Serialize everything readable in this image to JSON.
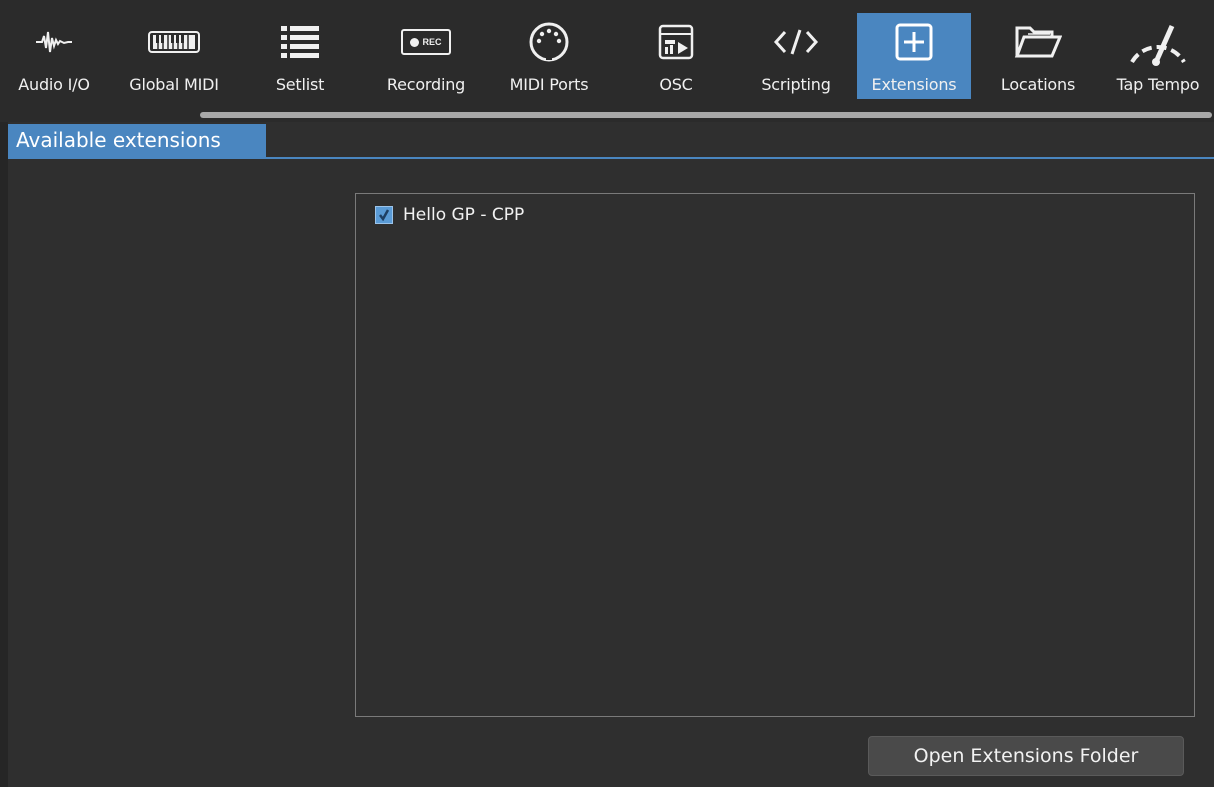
{
  "toolbar": {
    "items": [
      {
        "label": "Audio I/O",
        "icon": "waveform-icon",
        "active": false
      },
      {
        "label": "Global MIDI",
        "icon": "keyboard-icon",
        "active": false
      },
      {
        "label": "Setlist",
        "icon": "list-icon",
        "active": false
      },
      {
        "label": "Recording",
        "icon": "rec-icon",
        "active": false
      },
      {
        "label": "MIDI Ports",
        "icon": "midi-port-icon",
        "active": false
      },
      {
        "label": "OSC",
        "icon": "osc-icon",
        "active": false
      },
      {
        "label": "Scripting",
        "icon": "code-icon",
        "active": false
      },
      {
        "label": "Extensions",
        "icon": "plus-box-icon",
        "active": true
      },
      {
        "label": "Locations",
        "icon": "folder-icon",
        "active": false
      },
      {
        "label": "Tap Tempo",
        "icon": "gauge-icon",
        "active": false
      }
    ],
    "rec_badge": "REC"
  },
  "tabs": {
    "available": "Available extensions"
  },
  "extensions": {
    "items": [
      {
        "name": "Hello GP - CPP",
        "enabled": true
      }
    ]
  },
  "buttons": {
    "open_folder": "Open Extensions Folder"
  },
  "colors": {
    "accent": "#4a86c0",
    "background": "#2f2f2f",
    "toolbar_bg": "#2b2b2b"
  }
}
